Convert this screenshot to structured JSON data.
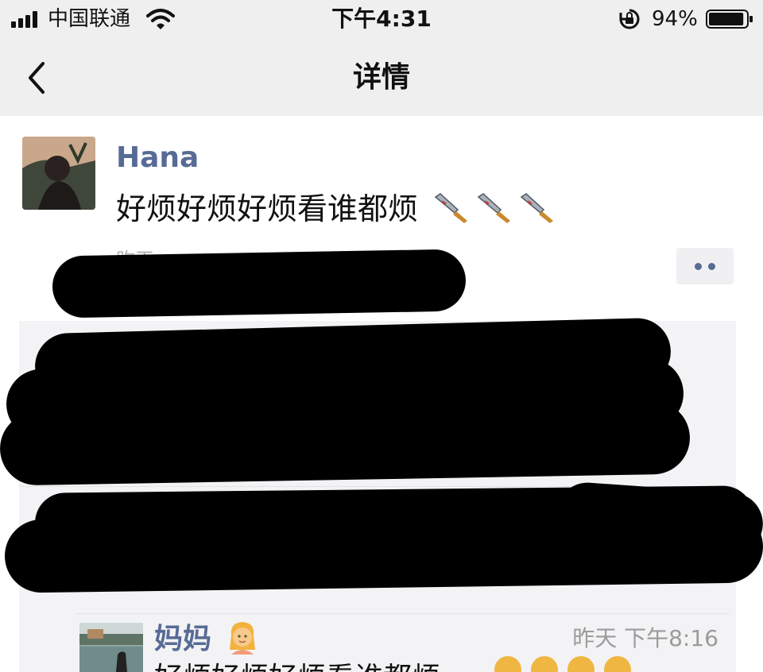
{
  "status_bar": {
    "carrier": "中国联通",
    "time": "下午4:31",
    "battery_percent": "94%",
    "signal_icon": "signal-bars-icon",
    "wifi_icon": "wifi-icon",
    "rotation_icon": "rotation-lock-icon",
    "battery_icon": "battery-icon",
    "battery_level": 0.94
  },
  "nav": {
    "title": "详情",
    "back_icon": "chevron-left-icon"
  },
  "post": {
    "author": "Hana",
    "text": "好烦好烦好烦看谁都烦",
    "emoji_icons": [
      "kitchen-knife-icon",
      "kitchen-knife-icon",
      "kitchen-knife-icon"
    ],
    "time_partial": "昨天",
    "more_icon": "more-dots-icon"
  },
  "comment": {
    "author": "妈妈",
    "author_emoji": "woman-emoji-icon",
    "time": "昨天 下午8:16",
    "text_partial": "好烦好烦好烦看谁都烦"
  },
  "colors": {
    "link_blue": "#576b95",
    "bar_gray": "#efefef",
    "comment_bg": "#f3f3f5",
    "time_gray": "#9b9b9b"
  }
}
